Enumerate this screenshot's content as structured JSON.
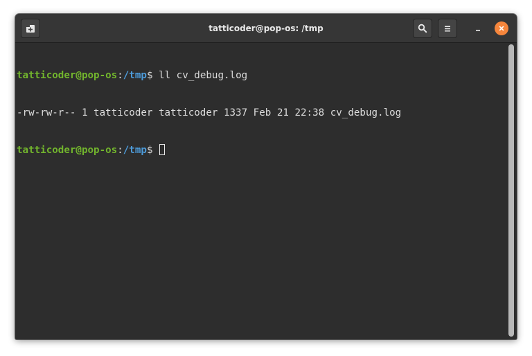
{
  "window": {
    "title": "tatticoder@pop-os: /tmp"
  },
  "titlebar": {
    "buttons": {
      "new_tab_icon": "new-tab-icon",
      "search_icon": "search-icon",
      "menu_icon": "hamburger-menu-icon",
      "minimize_icon": "minimize-icon",
      "close_icon": "close-icon"
    },
    "close_color": "#f6863c"
  },
  "terminal": {
    "colors": {
      "background": "#2d2d2d",
      "prompt_user": "#72b52d",
      "prompt_path": "#4d9bd9",
      "text": "#dcdcdc"
    },
    "lines": [
      {
        "prompt_user": "tatticoder@pop-os",
        "prompt_sep": ":",
        "prompt_path": "/tmp",
        "prompt_dollar": "$ ",
        "command": "ll cv_debug.log"
      },
      {
        "output": "-rw-rw-r-- 1 tatticoder tatticoder 1337 Feb 21 22:38 cv_debug.log"
      },
      {
        "prompt_user": "tatticoder@pop-os",
        "prompt_sep": ":",
        "prompt_path": "/tmp",
        "prompt_dollar": "$ ",
        "command": ""
      }
    ]
  }
}
